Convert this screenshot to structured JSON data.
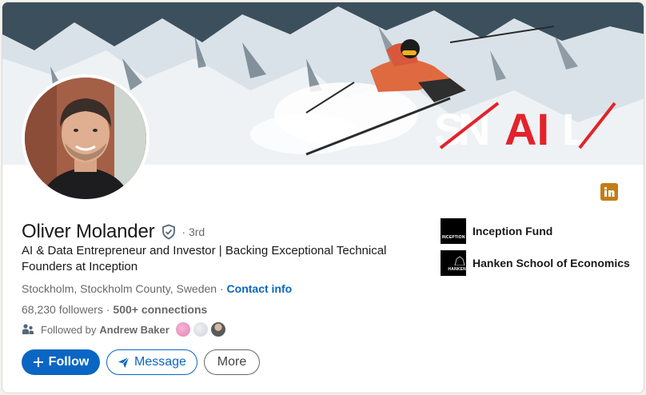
{
  "banner": {
    "brand_text": "SNAIL",
    "accent_color": "#e3232b"
  },
  "profile": {
    "name": "Oliver Molander",
    "degree": "· 3rd",
    "headline": "AI & Data Entrepreneur and Investor | Backing Exceptional Technical Founders at Inception",
    "location": "Stockholm, Stockholm County, Sweden",
    "location_sep": " · ",
    "contact_label": "Contact info",
    "followers": "68,230 followers",
    "connections": "500+ connections",
    "followed_by_prefix": "Followed by",
    "followed_by_name": "Andrew Baker"
  },
  "actions": {
    "follow": "Follow",
    "message": "Message",
    "more": "More"
  },
  "orgs": [
    {
      "name": "Inception Fund",
      "logo_text": "INCEPTION"
    },
    {
      "name": "Hanken School of Economics",
      "logo_text": "HANKEN"
    }
  ],
  "icons": {
    "verified": "shield-check-icon",
    "linkedin": "linkedin-icon",
    "people": "people-icon",
    "send": "send-icon",
    "plus": "plus-icon"
  },
  "colors": {
    "primary": "#0a66c2",
    "linkedin_badge": "#c37d16"
  }
}
